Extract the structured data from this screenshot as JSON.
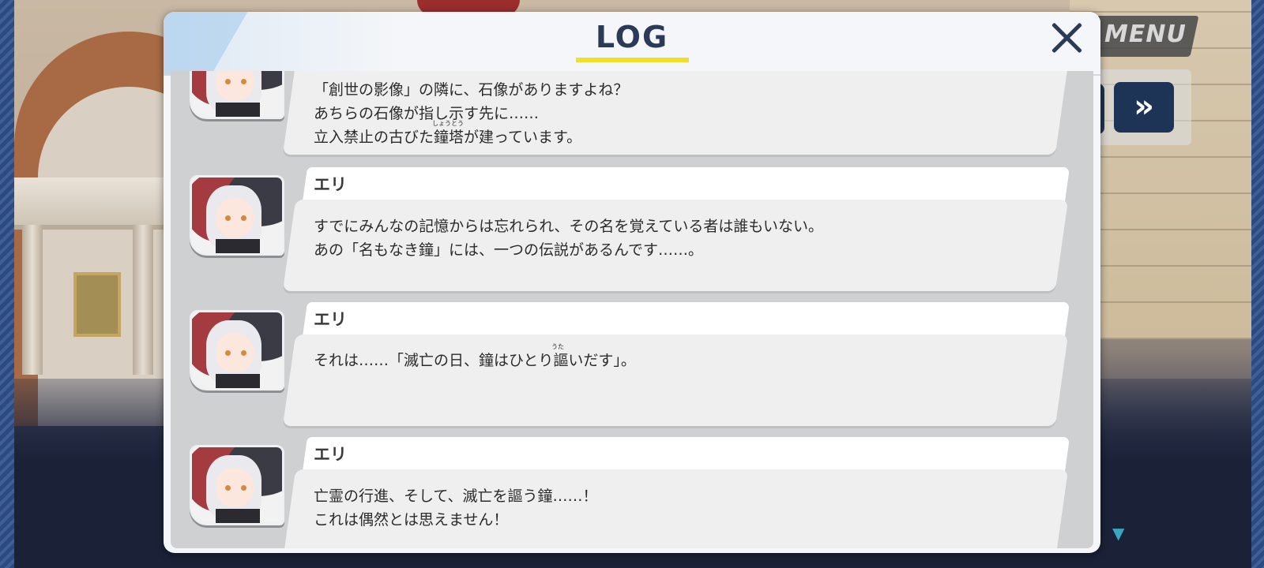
{
  "window": {
    "title": "LOG",
    "close_icon": "close-icon"
  },
  "hud": {
    "menu_label": "MENU",
    "skip_icon": "fast-forward-icon",
    "next_indicator_icon": "down-triangle-icon"
  },
  "log": {
    "entries": [
      {
        "speaker": "",
        "lines": [
          "「創世の影像」の隣に、石像がありますよね？",
          "あちらの石像が指し示す先に……",
          "立入禁止の古びた鐘塔が建っています。"
        ],
        "ruby": "しょうとう"
      },
      {
        "speaker": "エリ",
        "lines": [
          "すでにみんなの記憶からは忘れられ、その名を覚えている者は誰もいない。",
          "あの「名もなき鐘」には、一つの伝説があるんです……。"
        ]
      },
      {
        "speaker": "エリ",
        "lines": [
          "それは……「滅亡の日、鐘はひとり謳いだす」。"
        ],
        "ruby": "うた"
      },
      {
        "speaker": "エリ",
        "lines": [
          "亡霊の行進、そして、滅亡を謳う鐘……！",
          "これは偶然とは思えません！"
        ]
      }
    ]
  },
  "colors": {
    "title_text": "#2b3b57",
    "title_underline": "#f1df2a",
    "skip_button": "#1d3457",
    "indicator": "#3aa6c0"
  }
}
